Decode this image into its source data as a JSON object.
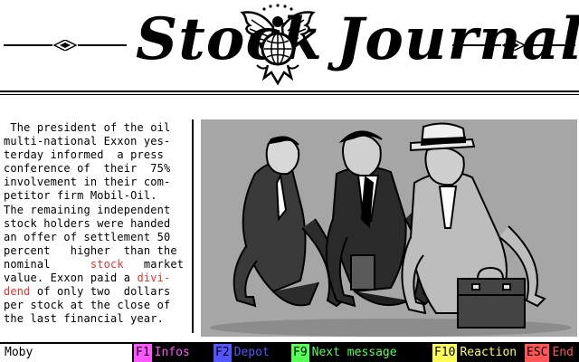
{
  "masthead": {
    "title_left": "Stock",
    "title_right": "Journal"
  },
  "article": {
    "lines": [
      [
        {
          "t": " The president of the oil"
        }
      ],
      [
        {
          "t": "multi-national Exxon yes-"
        }
      ],
      [
        {
          "t": "terday informed  a press"
        }
      ],
      [
        {
          "t": "conference of  their  75%"
        }
      ],
      [
        {
          "t": "involvement in their com-"
        }
      ],
      [
        {
          "t": "petitor firm Mobil-Oil."
        }
      ],
      [
        {
          "t": "The remaining independent"
        }
      ],
      [
        {
          "t": "stock holders were handed"
        }
      ],
      [
        {
          "t": "an offer of settlement 50"
        }
      ],
      [
        {
          "t": "percent   higher  than the"
        }
      ],
      [
        {
          "t": "nominal      "
        },
        {
          "t": "stock",
          "hl": true
        },
        {
          "t": "   market"
        }
      ],
      [
        {
          "t": "value. Exxon paid a "
        },
        {
          "t": "divi-",
          "hl": true
        }
      ],
      [
        {
          "t": "dend",
          "hl": true
        },
        {
          "t": " of only two  dollars"
        }
      ],
      [
        {
          "t": "per stock at the close of"
        }
      ],
      [
        {
          "t": "the last financial year."
        }
      ]
    ],
    "highlight_color": "#e8322e"
  },
  "picture": {
    "background": "#a6a6a6"
  },
  "statusbar": {
    "name": "Moby",
    "keys": [
      {
        "key": "F1",
        "label": "Infos",
        "key_bg": "#ff55ff",
        "label_color": "#ff55ff"
      },
      {
        "key": "F2",
        "label": "Depot",
        "key_bg": "#5555ff",
        "label_color": "#5555ff"
      },
      {
        "key": "F9",
        "label": "Next message",
        "key_bg": "#55ff55",
        "label_color": "#55ff55"
      },
      {
        "key": "F10",
        "label": "Reaction",
        "key_bg": "#ffff55",
        "label_color": "#ffff55"
      },
      {
        "key": "ESC",
        "label": "End",
        "key_bg": "#ff5555",
        "label_color": "#ff5555"
      }
    ]
  }
}
